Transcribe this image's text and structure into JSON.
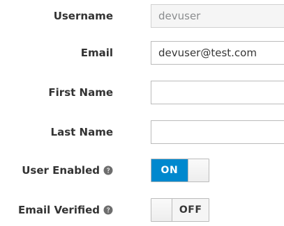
{
  "form": {
    "username": {
      "label": "Username",
      "value": "devuser",
      "readonly": true
    },
    "email": {
      "label": "Email",
      "value": "devuser@test.com"
    },
    "first_name": {
      "label": "First Name",
      "value": ""
    },
    "last_name": {
      "label": "Last Name",
      "value": ""
    },
    "user_enabled": {
      "label": "User Enabled",
      "state_text": "ON",
      "help_icon": "question-circle-icon"
    },
    "email_verified": {
      "label": "Email Verified",
      "state_text": "OFF",
      "help_icon": "question-circle-icon"
    }
  },
  "colors": {
    "toggle_on": "#0088ce",
    "label_text": "#333333",
    "input_border": "#bbbbbb",
    "readonly_bg": "#f5f5f5"
  }
}
